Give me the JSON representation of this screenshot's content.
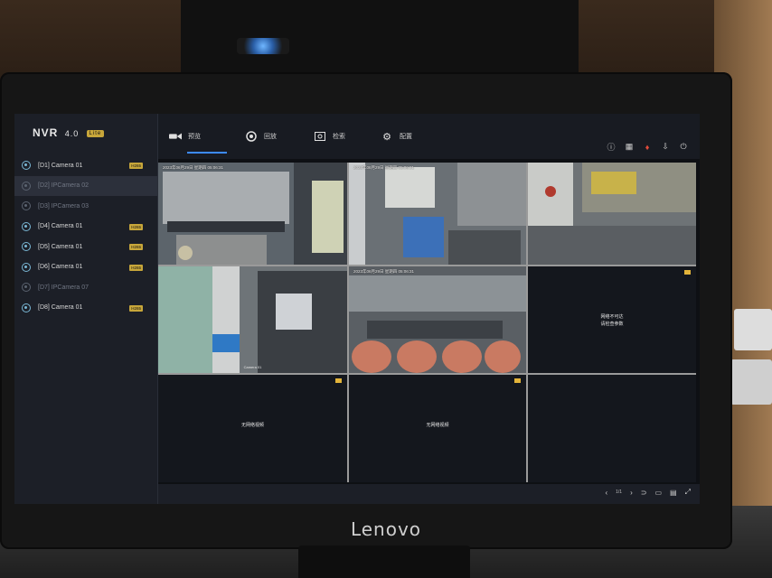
{
  "app": {
    "logo": "NVR",
    "version": "4.0",
    "edition": "Lite"
  },
  "sidebar": {
    "cameras": [
      {
        "label": "[D1] Camera 01",
        "badge": "H265",
        "online": true,
        "selected": false
      },
      {
        "label": "[D2] IPCamera 02",
        "badge": "",
        "online": false,
        "selected": true
      },
      {
        "label": "[D3] IPCamera 03",
        "badge": "",
        "online": false,
        "selected": false
      },
      {
        "label": "[D4] Camera 01",
        "badge": "H265",
        "online": true,
        "selected": false
      },
      {
        "label": "[D5] Camera 01",
        "badge": "H265",
        "online": true,
        "selected": false
      },
      {
        "label": "[D6] Camera 01",
        "badge": "H265",
        "online": true,
        "selected": false
      },
      {
        "label": "[D7] IPCamera 07",
        "badge": "",
        "online": false,
        "selected": false
      },
      {
        "label": "[D8] Camera 01",
        "badge": "H265",
        "online": true,
        "selected": false
      }
    ]
  },
  "topbar": {
    "tabs": [
      {
        "label": "预览",
        "icon": "preview-icon",
        "active": true
      },
      {
        "label": "回放",
        "icon": "playback-icon",
        "active": false
      },
      {
        "label": "检索",
        "icon": "search-icon",
        "active": false
      },
      {
        "label": "配置",
        "icon": "gear-icon",
        "active": false
      }
    ],
    "icons": [
      "info-icon",
      "grid-icon",
      "alarm-icon",
      "export-icon",
      "power-icon"
    ]
  },
  "grid": {
    "cells": [
      {
        "type": "video",
        "osd": "2023年06月29日 星期四 05:06:31",
        "camname": ""
      },
      {
        "type": "video",
        "osd": "2023年06月29日 星期四 05:06:31",
        "camname": ""
      },
      {
        "type": "video",
        "osd": "",
        "camname": ""
      },
      {
        "type": "video",
        "osd": "",
        "camname": "Camera 01"
      },
      {
        "type": "video",
        "osd": "2023年06月29日 星期四 05:06:31",
        "camname": ""
      },
      {
        "type": "message",
        "msg": "网络不可达",
        "sub": "请检查参数",
        "camname": ""
      },
      {
        "type": "message",
        "msg": "无网络视频",
        "sub": "",
        "camname": ""
      },
      {
        "type": "message",
        "msg": "无网络视频",
        "sub": "",
        "camname": ""
      },
      {
        "type": "blank",
        "msg": "",
        "sub": "",
        "camname": ""
      }
    ]
  },
  "statusbar": {
    "page": "1/1"
  },
  "monitor": {
    "brand": "Lenovo"
  },
  "colors": {
    "accent": "#3d8bff",
    "badge": "#c7a63a",
    "record": "#e3b43a"
  }
}
